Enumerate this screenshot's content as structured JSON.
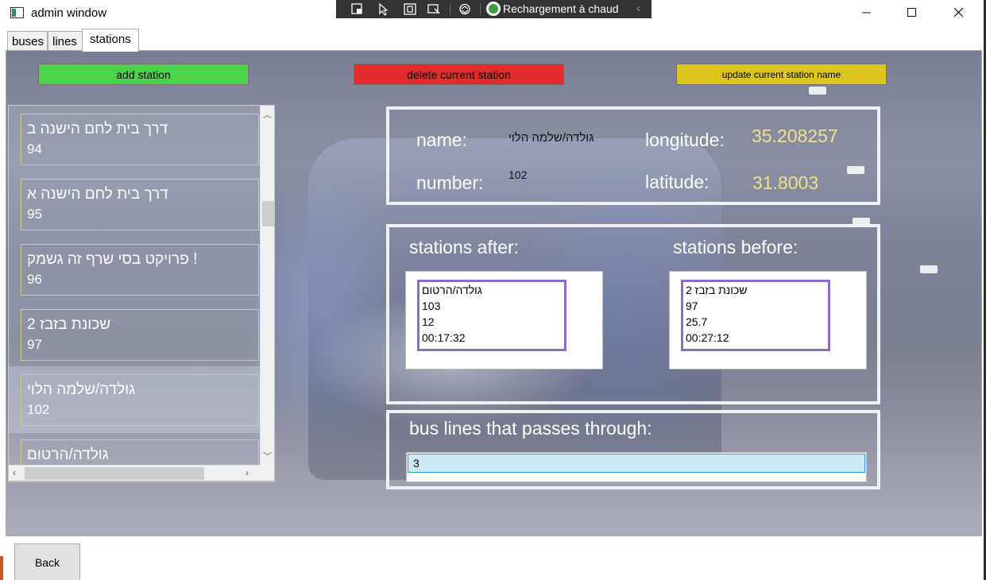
{
  "window": {
    "title": "admin window",
    "controls": {
      "minimize": "minimize",
      "maximize": "maximize",
      "close": "close"
    }
  },
  "devbar": {
    "icons": [
      "select-element-icon",
      "pointer-icon",
      "layout-adorner-icon",
      "track-focus-icon",
      "binding-failures-icon"
    ],
    "hot_reload_text": "Rechargement à chaud",
    "hot_reload_status": "ok"
  },
  "tabs": [
    {
      "label": "buses",
      "active": false
    },
    {
      "label": "lines",
      "active": false
    },
    {
      "label": "stations",
      "active": true
    }
  ],
  "actions": {
    "add_label": "add station",
    "delete_label": "delete current station",
    "update_label": "update current station name",
    "colors": {
      "add": "#4cd34c",
      "delete": "#e22b2b",
      "update": "#dcc51c"
    }
  },
  "stations_list": [
    {
      "name": "דרך בית לחם הישנה ב",
      "number": "94"
    },
    {
      "name": "דרך בית לחם הישנה א",
      "number": "95"
    },
    {
      "name": "פרויקט בסי שרף זה גשמק !",
      "number": "96"
    },
    {
      "name": "שכונת בזבז 2",
      "number": "97"
    },
    {
      "name": "גולדה/שלמה הלוי",
      "number": "102"
    },
    {
      "name": "גולדה/הרטום",
      "number": ""
    }
  ],
  "selected_station_index": 4,
  "details": {
    "name_label": "name:",
    "name_value": "גולדה/שלמה הלוי",
    "number_label": "number:",
    "number_value": "102",
    "longitude_label": "longitude:",
    "longitude_value": "35.208257",
    "latitude_label": "latitude:",
    "latitude_value": "31.8003"
  },
  "stations_after": {
    "label": "stations after:",
    "entry": {
      "name": "גולדה/הרטום",
      "number": "103",
      "distance": "12",
      "time": "00:17:32"
    }
  },
  "stations_before": {
    "label": "stations before:",
    "entry": {
      "name": "שכונת בזבז 2",
      "number": "97",
      "distance": "25.7",
      "time": "00:27:12"
    }
  },
  "bus_lines": {
    "label": "bus lines that passes through:",
    "items": [
      "3"
    ]
  },
  "footer": {
    "back_label": "Back"
  }
}
